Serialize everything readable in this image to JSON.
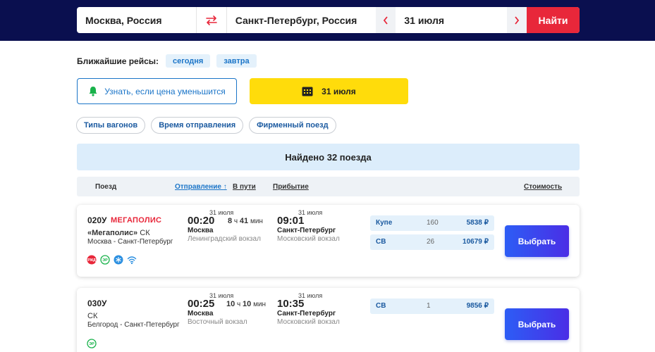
{
  "search": {
    "from": "Москва, Россия",
    "to": "Санкт-Петербург, Россия",
    "date": "31 июля",
    "find_label": "Найти"
  },
  "nearest": {
    "label": "Ближайшие рейсы:",
    "chips": [
      "сегодня",
      "завтра"
    ]
  },
  "notify_label": "Узнать, если цена уменьшится",
  "calendar_label": "31 июля",
  "filters": [
    "Типы вагонов",
    "Время отправления",
    "Фирменный поезд"
  ],
  "found_text": "Найдено 32 поезда",
  "table_header": {
    "train": "Поезд",
    "departure": "Отправление",
    "on_way": "В пути",
    "arrival": "Прибытие",
    "cost": "Стоимость"
  },
  "trains": [
    {
      "number": "020У",
      "brand": "МЕГАПОЛИС",
      "name_quoted": "«Мегаполис»",
      "name_suffix": " СК",
      "route": "Москва - Санкт-Петербург",
      "dep_date": "31 июля",
      "dep_time": "00:20",
      "dep_city": "Москва",
      "dep_station": "Ленинградский вокзал",
      "dur_h": "8",
      "dur_h_unit": "ч",
      "dur_m": "41",
      "dur_m_unit": "мин",
      "arr_date": "31 июля",
      "arr_time": "09:01",
      "arr_city": "Санкт-Петербург",
      "arr_station": "Московский вокзал",
      "fares": [
        {
          "class": "Купе",
          "seats": "160",
          "price": "5838 ₽"
        },
        {
          "class": "СВ",
          "seats": "26",
          "price": "10679 ₽"
        }
      ],
      "select_label": "Выбрать"
    },
    {
      "number": "030У",
      "brand": "",
      "name_quoted": "",
      "name_suffix": "СК",
      "route": "Белгород - Санкт-Петербург",
      "dep_date": "31 июля",
      "dep_time": "00:25",
      "dep_city": "Москва",
      "dep_station": "Восточный вокзал",
      "dur_h": "10",
      "dur_h_unit": "ч",
      "dur_m": "10",
      "dur_m_unit": "мин",
      "arr_date": "31 июля",
      "arr_time": "10:35",
      "arr_city": "Санкт-Петербург",
      "arr_station": "Московский вокзал",
      "fares": [
        {
          "class": "СВ",
          "seats": "1",
          "price": "9856 ₽"
        }
      ],
      "select_label": "Выбрать"
    }
  ],
  "colors": {
    "topbar": "#0a0f4f",
    "accent_red": "#e8273a",
    "accent_blue": "#1b75c8",
    "calendar_yellow": "#ffdc0b",
    "select_gradient_start": "#2d5df5",
    "select_gradient_end": "#4a2ee6"
  },
  "icons": {
    "swap": "swap-arrows-icon",
    "prev": "chevron-left-icon",
    "next": "chevron-right-icon",
    "notify": "bell-icon",
    "calendar": "calendar-icon",
    "rzd": "rzd-logo-icon",
    "electronic_registration": "er-icon",
    "climate": "snowflake-icon",
    "wifi": "wifi-icon"
  }
}
